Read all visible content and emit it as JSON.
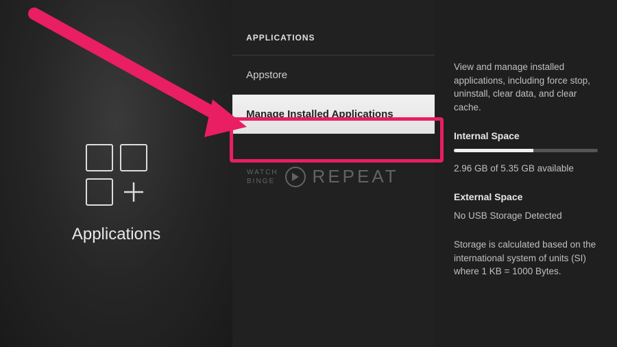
{
  "left": {
    "title": "Applications"
  },
  "section_header": "APPLICATIONS",
  "menu": {
    "appstore": "Appstore",
    "manage": "Manage Installed Applications"
  },
  "watermark": {
    "line1": "WATCH",
    "line2": "BINGE",
    "big": "REPEAT"
  },
  "right": {
    "description": "View and manage installed applications, including force stop, uninstall, clear data, and clear cache.",
    "internal_title": "Internal Space",
    "internal_value": "2.96 GB of 5.35 GB available",
    "external_title": "External Space",
    "external_value": "No USB Storage Detected",
    "footnote": "Storage is calculated based on the international system of units (SI) where 1 KB = 1000 Bytes."
  }
}
